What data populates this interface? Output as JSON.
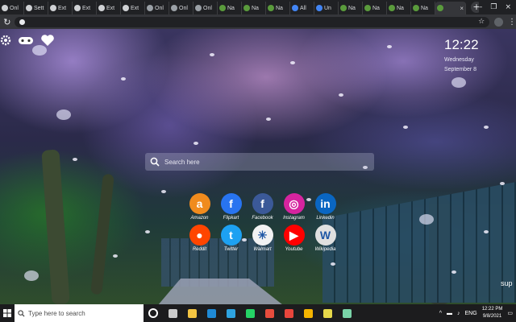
{
  "browser": {
    "tabs": [
      {
        "label": "Onl",
        "favicon_color": "#cfd1d4"
      },
      {
        "label": "Sett",
        "favicon_color": "#cfd1d4"
      },
      {
        "label": "Ext",
        "favicon_color": "#cfd1d4"
      },
      {
        "label": "Ext",
        "favicon_color": "#cfd1d4"
      },
      {
        "label": "Ext",
        "favicon_color": "#cfd1d4"
      },
      {
        "label": "Ext",
        "favicon_color": "#cfd1d4"
      },
      {
        "label": "Onl",
        "favicon_color": "#9aa0a6"
      },
      {
        "label": "Onl",
        "favicon_color": "#9aa0a6"
      },
      {
        "label": "Onl",
        "favicon_color": "#9aa0a6"
      },
      {
        "label": "Na",
        "favicon_color": "#5a9b3c"
      },
      {
        "label": "Na",
        "favicon_color": "#5a9b3c"
      },
      {
        "label": "Na",
        "favicon_color": "#5a9b3c"
      },
      {
        "label": "All",
        "favicon_color": "#4285f4"
      },
      {
        "label": "Un",
        "favicon_color": "#4285f4"
      },
      {
        "label": "Na",
        "favicon_color": "#5a9b3c"
      },
      {
        "label": "Na",
        "favicon_color": "#5a9b3c"
      },
      {
        "label": "Na",
        "favicon_color": "#5a9b3c"
      },
      {
        "label": "Na",
        "favicon_color": "#5a9b3c"
      }
    ],
    "active_tab": {
      "label": "",
      "close": "×"
    },
    "new_tab": "+",
    "window_controls": {
      "minimize": "–",
      "maximize": "❐",
      "close": "×"
    },
    "omnibox_value": "",
    "star": "☆"
  },
  "newtab": {
    "clock": {
      "time": "12:22",
      "day": "Wednesday",
      "date": "September 8"
    },
    "search_placeholder": "Search here",
    "corner_text": "sup",
    "shortcuts": [
      {
        "label": "Amazon",
        "glyph": "a",
        "color": "#f08b1d"
      },
      {
        "label": "Flipkart",
        "glyph": "f",
        "color": "#2874f0"
      },
      {
        "label": "Facebook",
        "glyph": "f",
        "color": "#3b5998"
      },
      {
        "label": "Instagram",
        "glyph": "◎",
        "color": "#d6249f"
      },
      {
        "label": "Linkedin",
        "glyph": "in",
        "color": "#0a66c2"
      },
      {
        "label": "Reddit",
        "glyph": "●",
        "color": "#ff4500"
      },
      {
        "label": "Twitter",
        "glyph": "t",
        "color": "#1da1f2"
      },
      {
        "label": "Walmart",
        "glyph": "✳",
        "color": "#f2f2f2"
      },
      {
        "label": "Youtube",
        "glyph": "▶",
        "color": "#ff0000"
      },
      {
        "label": "Wikipedia",
        "glyph": "W",
        "color": "#e0e0e0"
      }
    ]
  },
  "taskbar": {
    "search_text": "Type here to search",
    "apps": [
      {
        "name": "cortana-icon",
        "color": "#ffffff"
      },
      {
        "name": "task-view-icon",
        "color": "#cccccc"
      },
      {
        "name": "file-explorer-icon",
        "color": "#f4c542"
      },
      {
        "name": "store-icon",
        "color": "#1f8ad6"
      },
      {
        "name": "edge-icon",
        "color": "#2ea3e0"
      },
      {
        "name": "whatsapp-icon",
        "color": "#25d366"
      },
      {
        "name": "office-icon",
        "color": "#e84c3d"
      },
      {
        "name": "chrome-icon",
        "color": "#e8453c"
      },
      {
        "name": "chrome-canary-icon",
        "color": "#f5b400"
      },
      {
        "name": "notes-icon",
        "color": "#e6d84a"
      },
      {
        "name": "app-icon",
        "color": "#7ad3a8"
      }
    ],
    "tray": {
      "chevron": "^",
      "language": "ENG",
      "time": "12:22 PM",
      "date": "9/8/2021"
    }
  }
}
